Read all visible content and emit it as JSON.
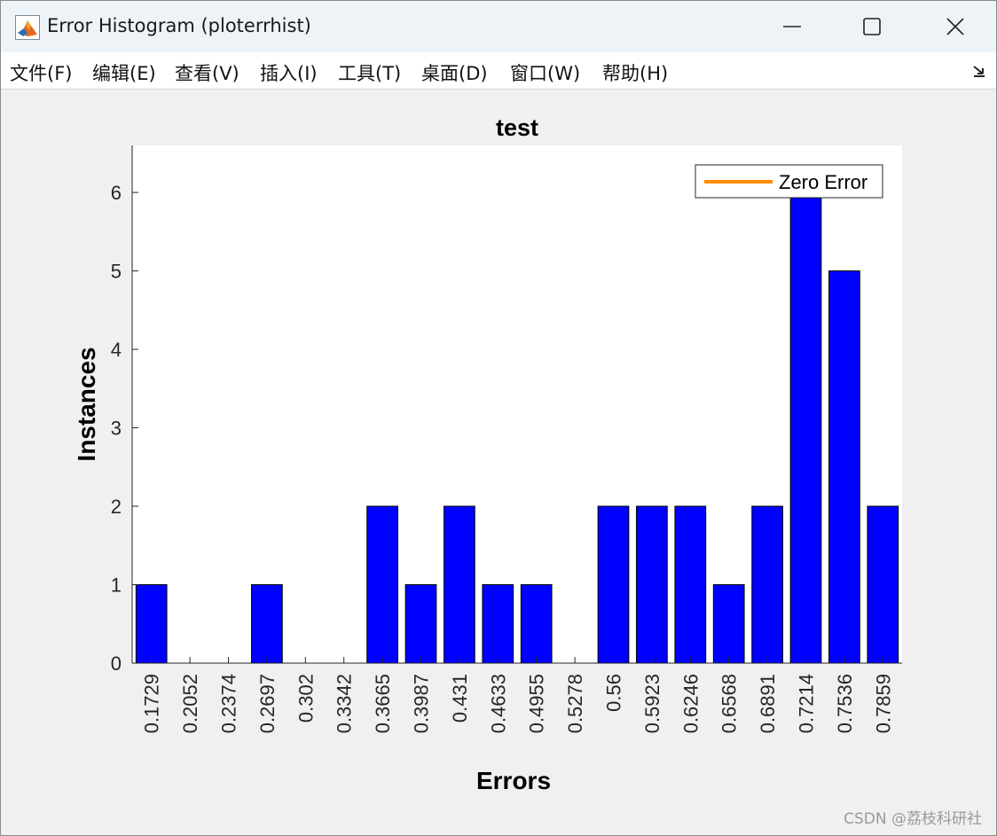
{
  "window": {
    "title": "Error Histogram (ploterrhist)"
  },
  "menu": {
    "items": [
      "文件(F)",
      "编辑(E)",
      "查看(V)",
      "插入(I)",
      "工具(T)",
      "桌面(D)",
      "窗口(W)",
      "帮助(H)"
    ]
  },
  "watermark": "CSDN @荔枝科研社",
  "colors": {
    "bar": "#0000ff",
    "zero_error_line": "#ff8c00",
    "titlebar": "#eef3f8",
    "figure_bg": "#f0f0f0"
  },
  "chart_data": {
    "type": "bar",
    "title": "test",
    "xlabel": "Errors",
    "ylabel": "Instances",
    "categories": [
      "0.1729",
      "0.2052",
      "0.2374",
      "0.2697",
      "0.302",
      "0.3342",
      "0.3665",
      "0.3987",
      "0.431",
      "0.4633",
      "0.4955",
      "0.5278",
      "0.56",
      "0.5923",
      "0.6246",
      "0.6568",
      "0.6891",
      "0.7214",
      "0.7536",
      "0.7859"
    ],
    "values": [
      1,
      0,
      0,
      1,
      0,
      0,
      2,
      1,
      2,
      1,
      1,
      0,
      2,
      2,
      2,
      1,
      2,
      6,
      5,
      2
    ],
    "ylim": [
      0,
      6.6
    ],
    "yticks": [
      0,
      1,
      2,
      3,
      4,
      5,
      6
    ],
    "legend": {
      "entries": [
        "Zero Error"
      ],
      "placement": "top-right"
    },
    "grid": false
  }
}
